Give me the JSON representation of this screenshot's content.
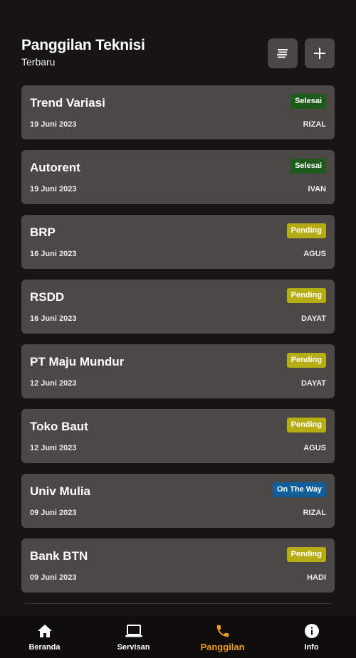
{
  "header": {
    "title": "Panggilan Teknisi",
    "subtitle": "Terbaru",
    "sort_icon": "sort-icon",
    "add_icon": "plus-icon"
  },
  "calls": [
    {
      "name": "Trend Variasi",
      "status": "Selesai",
      "status_type": "done",
      "date": "19 Juni 2023",
      "technician": "RIZAL"
    },
    {
      "name": "Autorent",
      "status": "Selesai",
      "status_type": "done",
      "date": "19 Juni 2023",
      "technician": "IVAN"
    },
    {
      "name": "BRP",
      "status": "Pending",
      "status_type": "pending",
      "date": "16 Juni 2023",
      "technician": "AGUS"
    },
    {
      "name": "RSDD",
      "status": "Pending",
      "status_type": "pending",
      "date": "16 Juni 2023",
      "technician": "DAYAT"
    },
    {
      "name": "PT Maju Mundur",
      "status": "Pending",
      "status_type": "pending",
      "date": "12 Juni 2023",
      "technician": "DAYAT"
    },
    {
      "name": "Toko Baut",
      "status": "Pending",
      "status_type": "pending",
      "date": "12 Juni 2023",
      "technician": "AGUS"
    },
    {
      "name": "Univ Mulia",
      "status": "On The Way",
      "status_type": "otw",
      "date": "09 Juni 2023",
      "technician": "RIZAL"
    },
    {
      "name": "Bank BTN",
      "status": "Pending",
      "status_type": "pending",
      "date": "09 Juni 2023",
      "technician": "HADI"
    }
  ],
  "nav": {
    "items": [
      {
        "label": "Beranda",
        "icon": "home-icon"
      },
      {
        "label": "Servisan",
        "icon": "laptop-icon"
      },
      {
        "label": "Panggilan",
        "icon": "phone-icon"
      },
      {
        "label": "Info",
        "icon": "info-icon"
      }
    ],
    "active": "Panggilan"
  },
  "colors": {
    "background": "#161513",
    "card": "#4b4845",
    "done": "#1f5a1d",
    "pending": "#b6ad16",
    "on_the_way": "#0e5f9b",
    "accent": "#f39a1e"
  }
}
